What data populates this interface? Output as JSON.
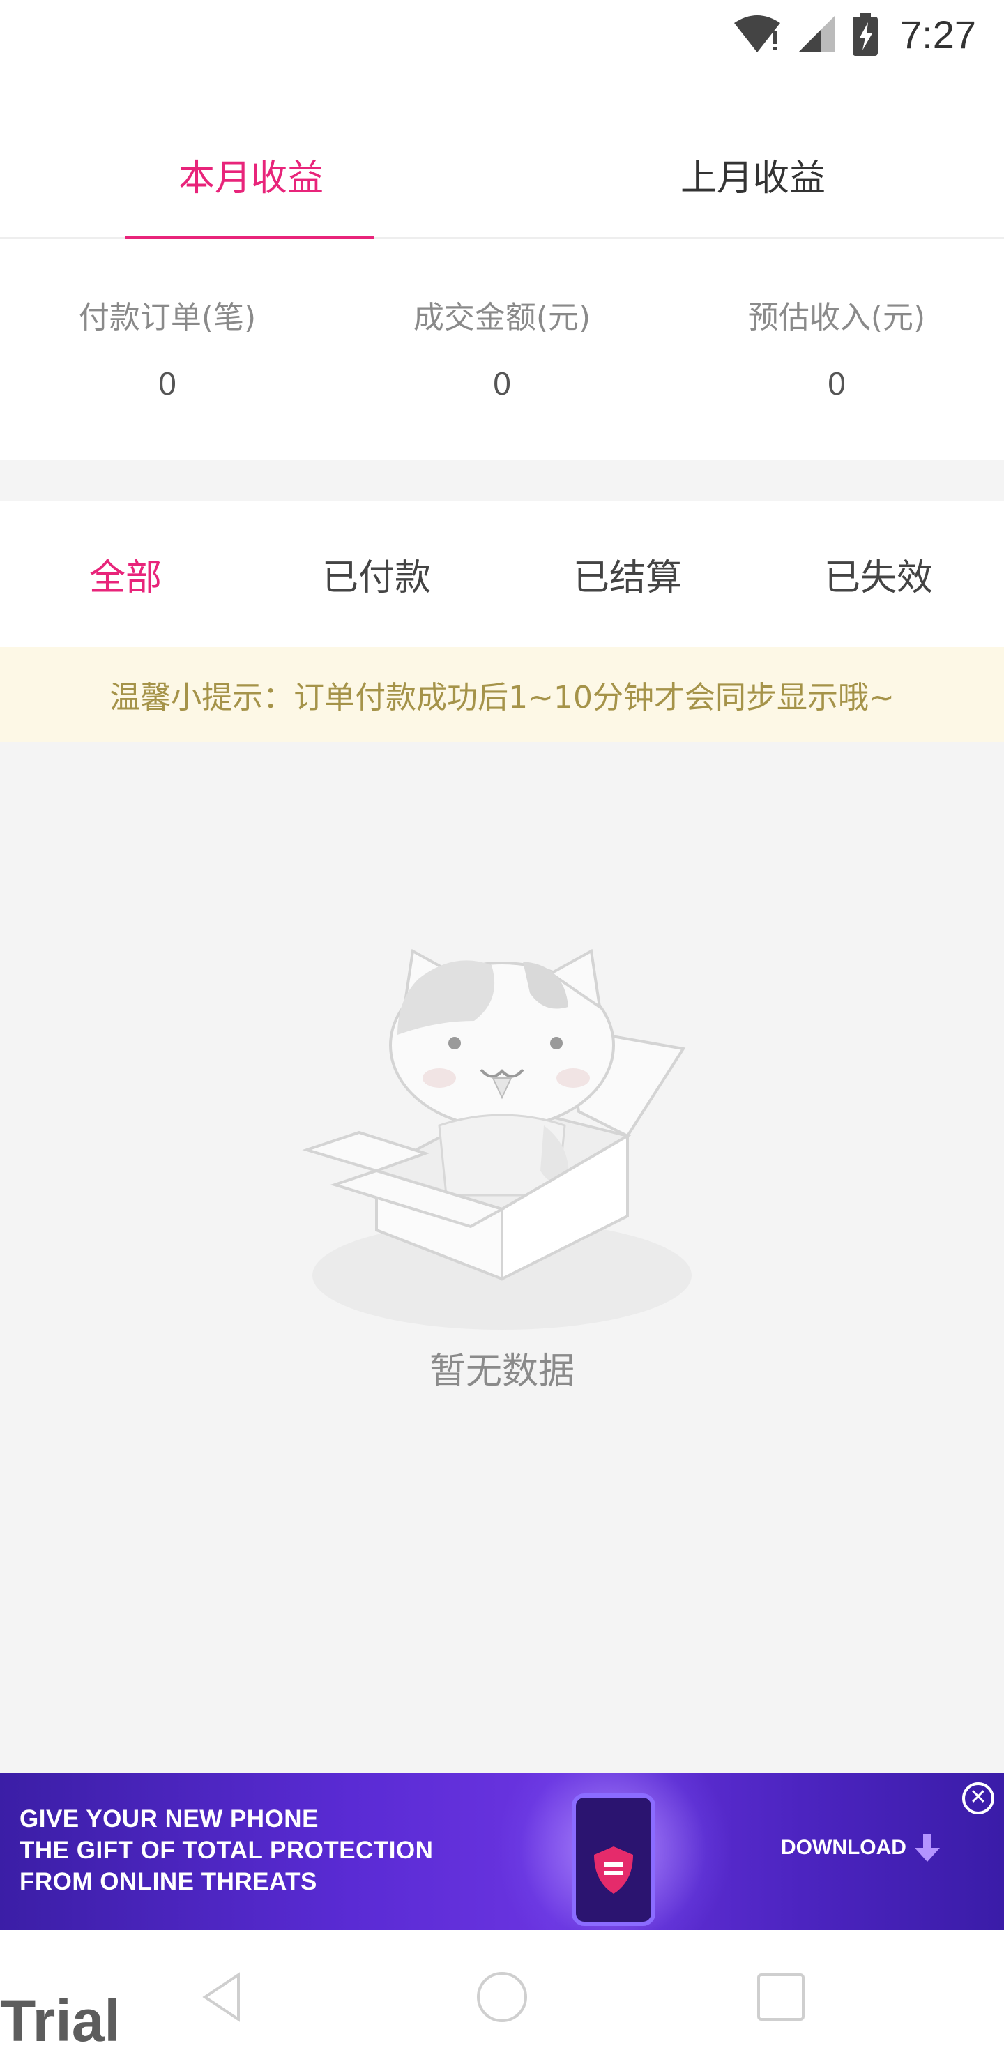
{
  "status_bar": {
    "time": "7:27",
    "icons": [
      "wifi-icon",
      "signal-icon",
      "battery-charging-icon"
    ]
  },
  "top_tabs": [
    {
      "label": "本月收益",
      "active": true
    },
    {
      "label": "上月收益",
      "active": false
    }
  ],
  "stats": [
    {
      "label": "付款订单(笔)",
      "value": "0"
    },
    {
      "label": "成交金额(元)",
      "value": "0"
    },
    {
      "label": "预估收入(元)",
      "value": "0"
    }
  ],
  "filter_tabs": [
    {
      "label": "全部",
      "active": true
    },
    {
      "label": "已付款",
      "active": false
    },
    {
      "label": "已结算",
      "active": false
    },
    {
      "label": "已失效",
      "active": false
    }
  ],
  "tip": {
    "text": "温馨小提示：订单付款成功后1~10分钟才会同步显示哦~"
  },
  "empty_state": {
    "text": "暂无数据",
    "illustration": "cat-in-box-illustration"
  },
  "ad": {
    "line1": "GIVE YOUR NEW PHONE",
    "line2": "THE GIFT OF TOTAL PROTECTION",
    "line3": "FROM ONLINE THREATS",
    "cta": "DOWNLOAD",
    "close_symbol": "✕"
  },
  "watermark": "Trial",
  "colors": {
    "accent": "#e8247a",
    "tip_bg": "#fdf8e6",
    "tip_text": "#a59349",
    "page_bg": "#f4f4f4"
  }
}
